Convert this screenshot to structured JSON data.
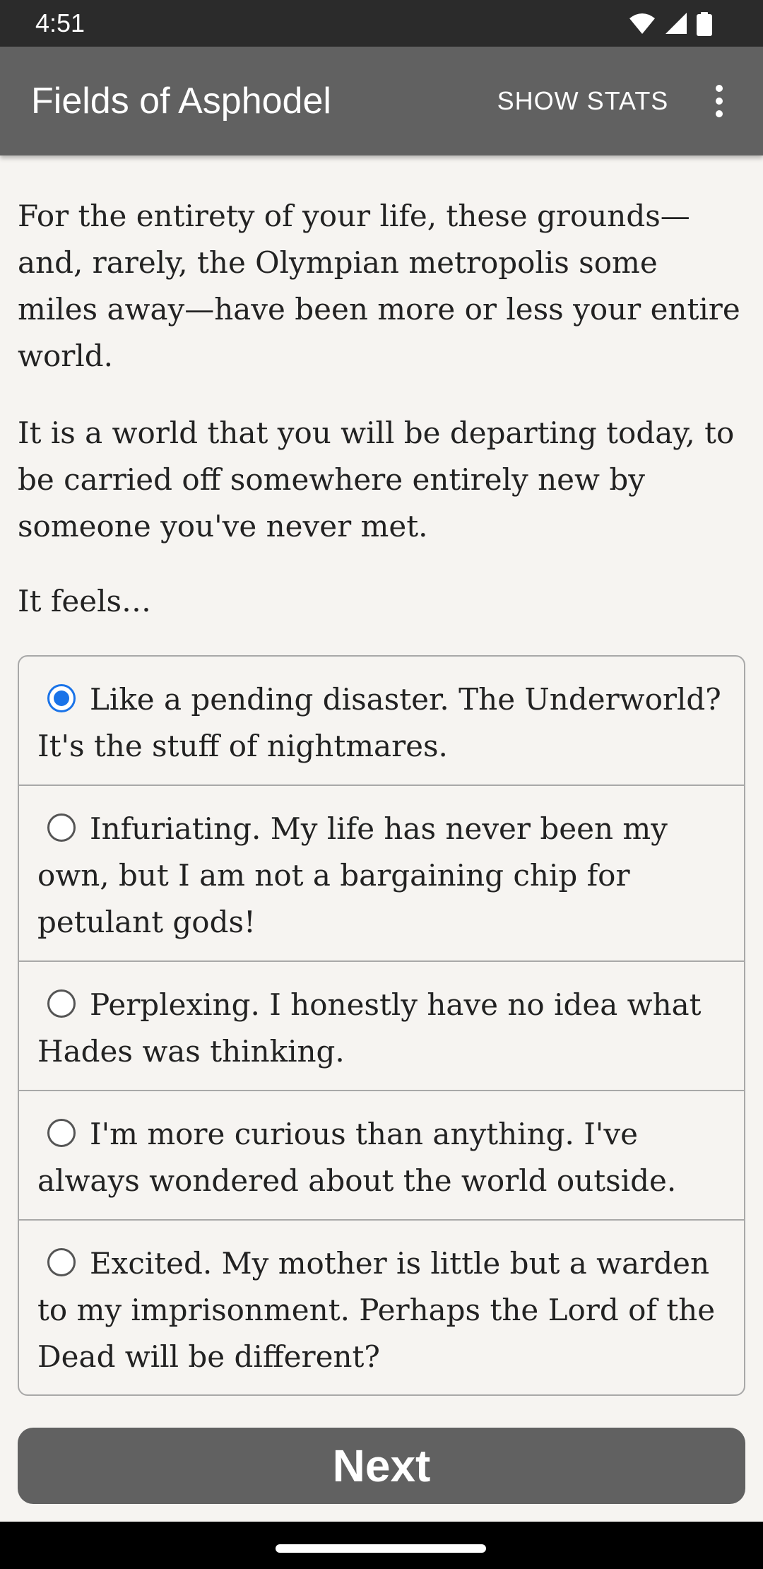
{
  "status_bar": {
    "time": "4:51",
    "icons": [
      "wifi-icon",
      "cell-signal-icon",
      "battery-icon"
    ]
  },
  "app_bar": {
    "title": "Fields of Asphodel",
    "show_stats_label": "SHOW STATS",
    "overflow_icon": "more-vert-icon"
  },
  "story": {
    "paragraphs": [
      "For the entirety of your life, these grounds—and, rarely, the Olympian metropolis some miles away—have been more or less your entire world.",
      "It is a world that you will be departing today, to be carried off somewhere entirely new by someone you've never met.",
      "It feels…"
    ]
  },
  "choices": [
    {
      "label": "Like a pending disaster. The Underworld? It's the stuff of nightmares.",
      "selected": true
    },
    {
      "label": "Infuriating. My life has never been my own, but I am not a bargaining chip for petulant gods!",
      "selected": false
    },
    {
      "label": "Perplexing. I honestly have no idea what Hades was thinking.",
      "selected": false
    },
    {
      "label": "I'm more curious than anything. I've always wondered about the world outside.",
      "selected": false
    },
    {
      "label": "Excited. My mother is little but a warden to my imprisonment. Perhaps the Lord of the Dead will be different?",
      "selected": false
    }
  ],
  "next_button_label": "Next",
  "colors": {
    "app_bar": "#616161",
    "status_bar": "#2b2b2b",
    "background": "#f6f4f1",
    "radio_selected": "#1a73e8",
    "button": "#616161"
  }
}
